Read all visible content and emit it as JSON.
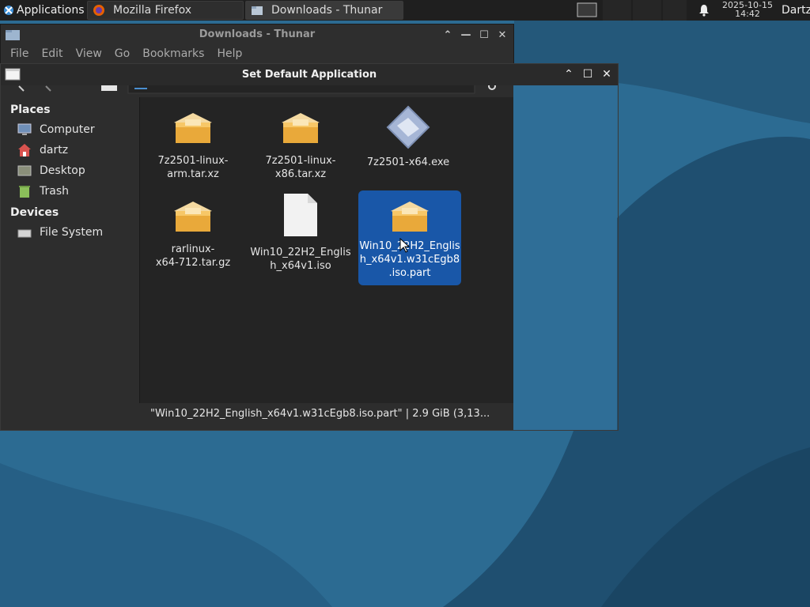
{
  "panel": {
    "applications_label": "Applications",
    "tasks": [
      {
        "label": "Mozilla Firefox"
      },
      {
        "label": "Downloads - Thunar"
      }
    ],
    "clock_date": "2025-10-15",
    "clock_time": "14:42",
    "user": "Dartz"
  },
  "thunar": {
    "title": "Downloads - Thunar",
    "menu": [
      "File",
      "Edit",
      "View",
      "Go",
      "Bookmarks",
      "Help"
    ],
    "places_heading": "Places",
    "places": [
      "Computer",
      "dartz",
      "Desktop",
      "Trash"
    ],
    "devices_heading": "Devices",
    "devices": [
      "File System"
    ],
    "files": [
      {
        "name": "7z2501-linux-\narm.tar.xz",
        "icon": "archive-icon"
      },
      {
        "name": "7z2501-linux-\nx86.tar.xz",
        "icon": "archive-icon"
      },
      {
        "name": "7z2501-x64.exe",
        "icon": "executable-icon"
      },
      {
        "name": "rarlinux-\nx64-712.tar.gz",
        "icon": "archive-icon"
      },
      {
        "name": "Win10_22H2_Englis\nh_x64v1.iso",
        "icon": "document-icon"
      },
      {
        "name": "Win10_22H2_Englis\nh_x64v1.w31cEgb8\n.iso.part",
        "icon": "archive-icon",
        "selected": true
      }
    ],
    "status": "\"Win10_22H2_English_x64v1.w31cEgb8.iso.part\"  |  2.9 GiB (3,13..."
  },
  "dialog": {
    "title": "Set Default Application"
  },
  "colors": {
    "selection": "#1957a8",
    "desktop": "#2b6a8f",
    "panel": "#1f1f1f"
  }
}
